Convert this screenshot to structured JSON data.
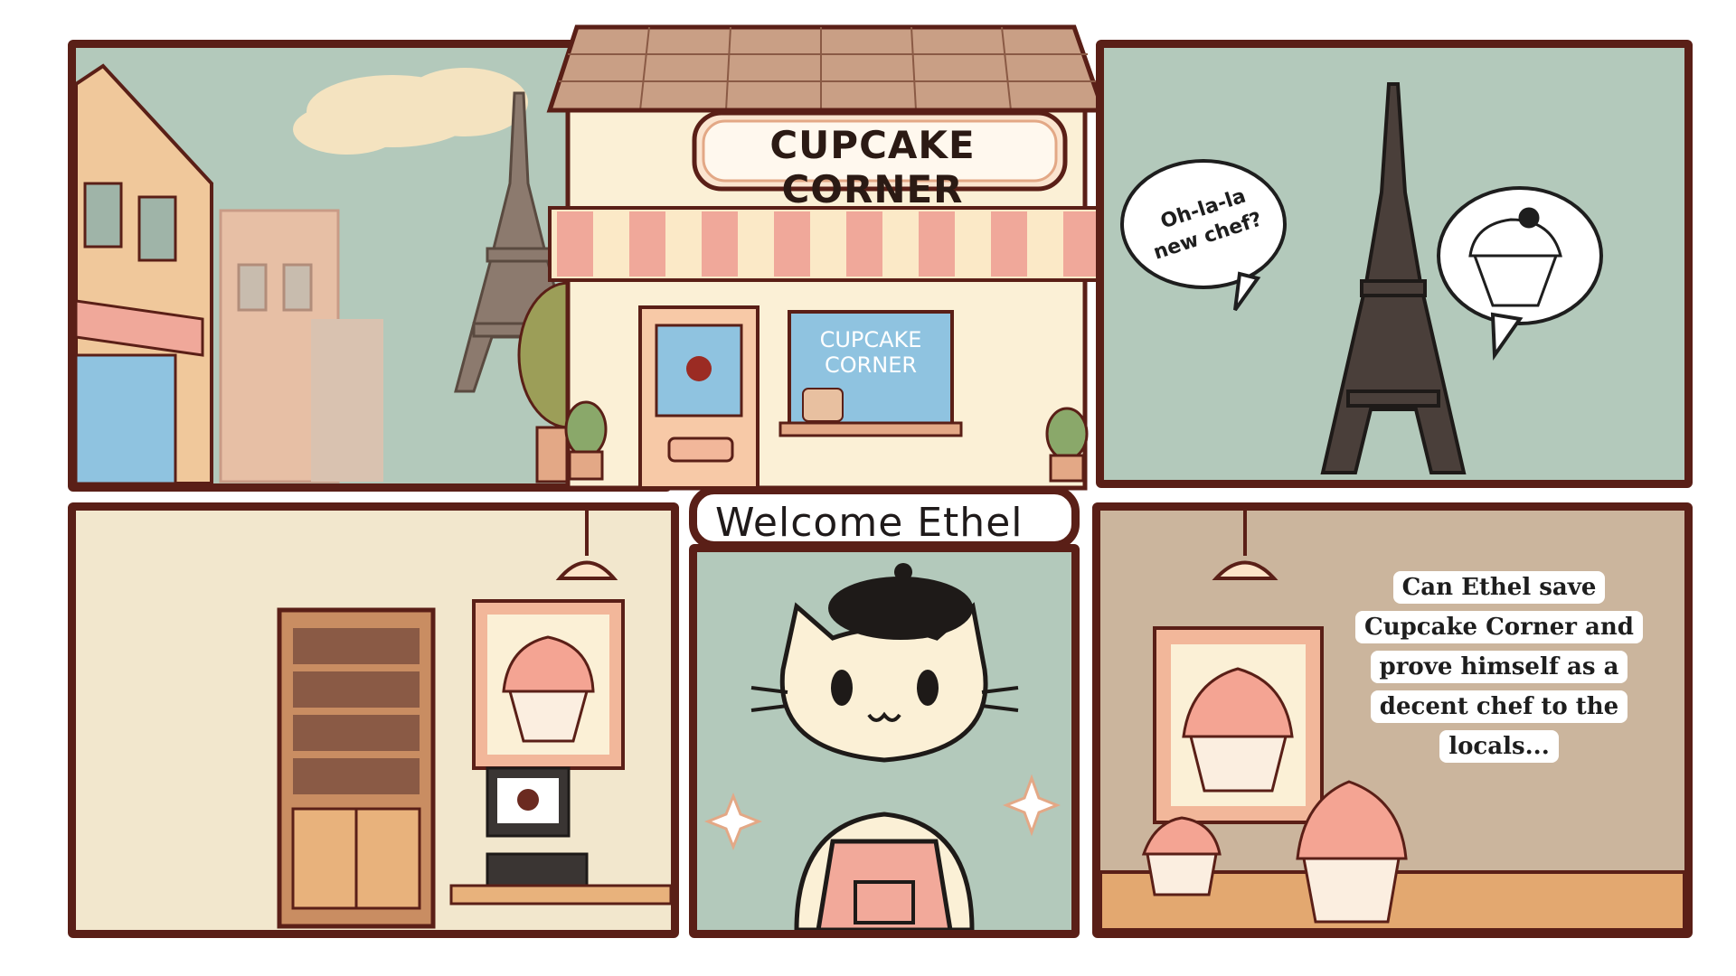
{
  "comic": {
    "shop_sign": "CUPCAKE CORNER",
    "window_sign_line1": "CUPCAKE",
    "window_sign_line2": "CORNER",
    "welcome": "Welcome Ethel",
    "speech_bubble_line1": "Oh-la-la",
    "speech_bubble_line2": "new chef?",
    "caption_line1": "Can Ethel save",
    "caption_line2": "Cupcake Corner and",
    "caption_line3": "prove himself as a",
    "caption_line4": "decent chef to the",
    "caption_line5": "locals..."
  },
  "colors": {
    "frame": "#5a1f17",
    "sky_mint": "#b3c9bb",
    "awning_pink": "#f0a89a",
    "cupcake_frosting": "#f4a493",
    "wall_cream": "#f2e7cd",
    "wall_tan": "#cbb59d"
  },
  "icons": [
    "eiffel-tower-icon",
    "cupcake-icon",
    "cat-chef-icon",
    "sparkle-icon",
    "lamp-icon",
    "cash-register-icon"
  ]
}
